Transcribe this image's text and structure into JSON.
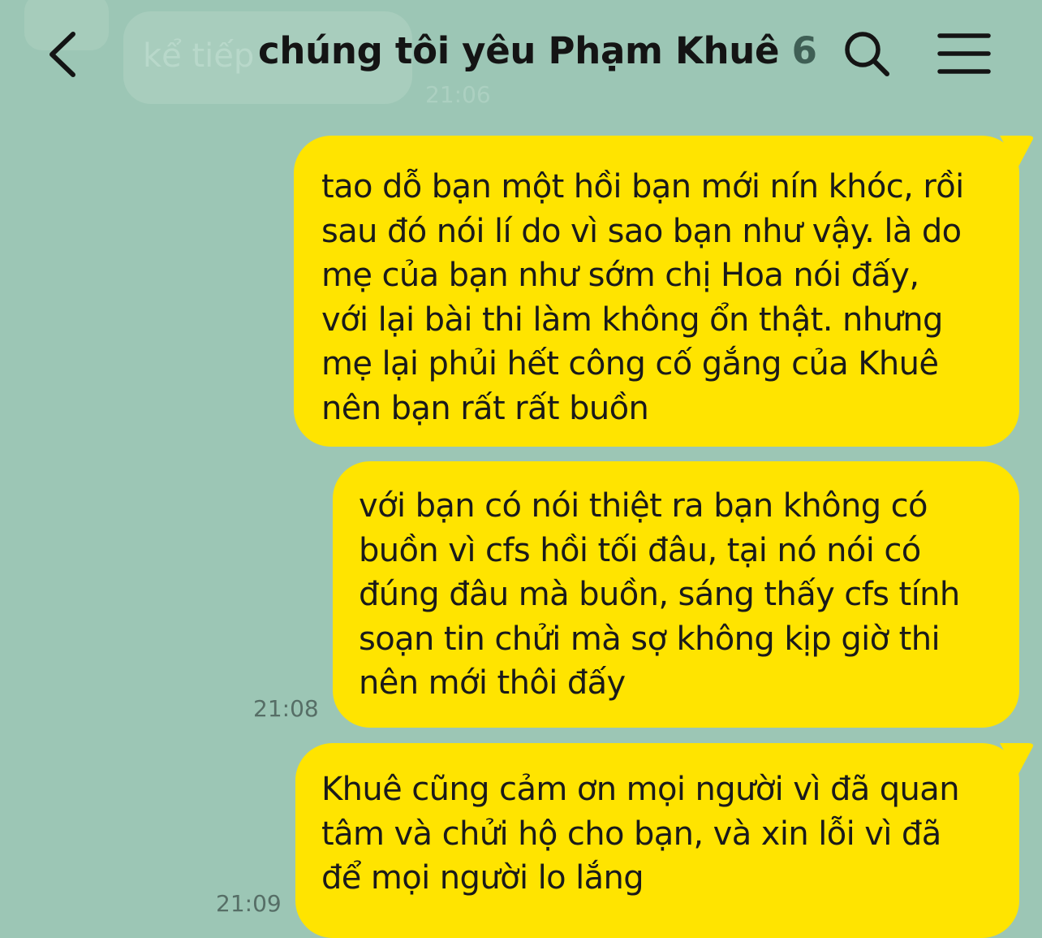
{
  "background_color": "#9cc6b5",
  "bubble_color": "#ffe400",
  "header": {
    "title": "chúng tôi yêu Phạm Khuê",
    "member_count": "6",
    "back_icon": "chevron-left-icon",
    "search_icon": "search-icon",
    "menu_icon": "hamburger-menu-icon"
  },
  "previous_message": {
    "text": "kể tiếp",
    "time": "21:06"
  },
  "messages": [
    {
      "lines": [
        "tao dỗ bạn một hồi bạn mới nín khóc, rồi",
        "sau đó nói lí do vì sao bạn như vậy. là do",
        "mẹ của bạn như sớm chị Hoa nói đấy,",
        "với lại bài thi làm không ổn thật. nhưng",
        "mẹ lại phủi hết công cố gắng của Khuê",
        "nên bạn rất rất buồn"
      ],
      "time": ""
    },
    {
      "lines": [
        "với bạn có nói thiệt ra bạn không có",
        "buồn vì cfs hồi tối đâu, tại nó nói có",
        "đúng đâu mà buồn, sáng thấy cfs tính",
        "soạn tin chửi mà sợ không kịp giờ thi",
        "nên mới thôi đấy"
      ],
      "time": "21:08"
    },
    {
      "lines": [
        "Khuê cũng cảm ơn mọi người vì đã quan",
        "tâm và chửi hộ cho bạn, và xin lỗi vì đã",
        "để mọi người lo lắng"
      ],
      "time": "21:09"
    }
  ]
}
